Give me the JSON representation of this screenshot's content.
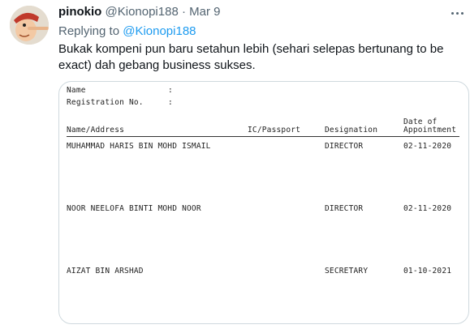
{
  "tweet": {
    "display_name": "pinokio",
    "handle": "@Kionopi188",
    "separator": "·",
    "date": "Mar 9",
    "replying_to_label": "Replying to",
    "replying_to_handle": "@Kionopi188",
    "text": "Bukak kompeni pun baru setahun lebih (sehari selepas bertunang to be exact) dah gebang business sukses.",
    "more_icon": "more-horizontal-icon",
    "accent_color": "#1d9bf0"
  },
  "document": {
    "name_label": "Name",
    "registration_label": "Registration No.",
    "colon": ":",
    "headers": {
      "name_address": "Name/Address",
      "ic_passport": "IC/Passport",
      "designation": "Designation",
      "date_line1": "Date of",
      "date_line2": "Appointment"
    },
    "rows": [
      {
        "name": "MUHAMMAD HARIS BIN MOHD ISMAIL",
        "designation": "DIRECTOR",
        "date": "02-11-2020"
      },
      {
        "name": "NOOR NEELOFA BINTI MOHD NOOR",
        "designation": "DIRECTOR",
        "date": "02-11-2020"
      },
      {
        "name": "AIZAT BIN ARSHAD",
        "designation": "SECRETARY",
        "date": "01-10-2021"
      }
    ]
  }
}
